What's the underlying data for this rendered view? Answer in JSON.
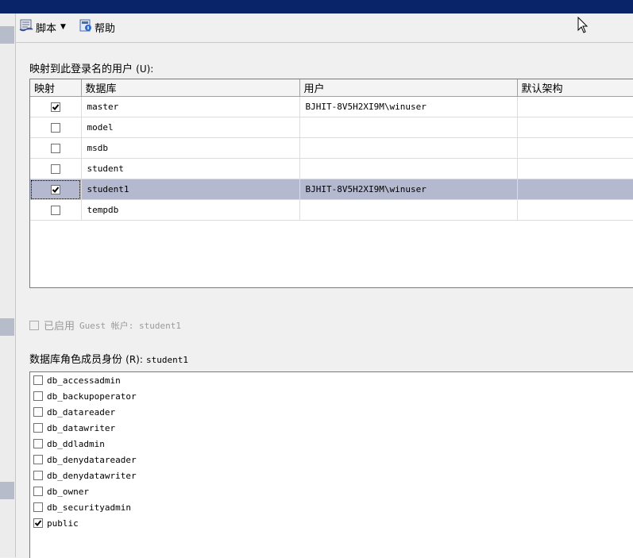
{
  "toolbar": {
    "script_label": "脚本",
    "help_label": "帮助"
  },
  "mapping": {
    "label": "映射到此登录名的用户",
    "shortcut": "(U):",
    "columns": {
      "map": "映射",
      "database": "数据库",
      "user": "用户",
      "schema": "默认架构"
    },
    "rows": [
      {
        "checked": true,
        "database": "master",
        "user": "BJHIT-8V5H2XI9M\\winuser",
        "schema": ""
      },
      {
        "checked": false,
        "database": "model",
        "user": "",
        "schema": ""
      },
      {
        "checked": false,
        "database": "msdb",
        "user": "",
        "schema": ""
      },
      {
        "checked": false,
        "database": "student",
        "user": "",
        "schema": ""
      },
      {
        "checked": true,
        "database": "student1",
        "user": "BJHIT-8V5H2XI9M\\winuser",
        "schema": "",
        "selected": true
      },
      {
        "checked": false,
        "database": "tempdb",
        "user": "",
        "schema": ""
      }
    ]
  },
  "guest": {
    "label": "已启用",
    "text": "Guest 帐户: student1",
    "checked": false
  },
  "roles": {
    "label": "数据库角色成员身份",
    "shortcut": "(R):",
    "db_name": "student1",
    "items": [
      {
        "name": "db_accessadmin",
        "checked": false
      },
      {
        "name": "db_backupoperator",
        "checked": false
      },
      {
        "name": "db_datareader",
        "checked": false
      },
      {
        "name": "db_datawriter",
        "checked": false
      },
      {
        "name": "db_ddladmin",
        "checked": false
      },
      {
        "name": "db_denydatareader",
        "checked": false
      },
      {
        "name": "db_denydatawriter",
        "checked": false
      },
      {
        "name": "db_owner",
        "checked": false
      },
      {
        "name": "db_securityadmin",
        "checked": false
      },
      {
        "name": "public",
        "checked": true
      }
    ]
  }
}
